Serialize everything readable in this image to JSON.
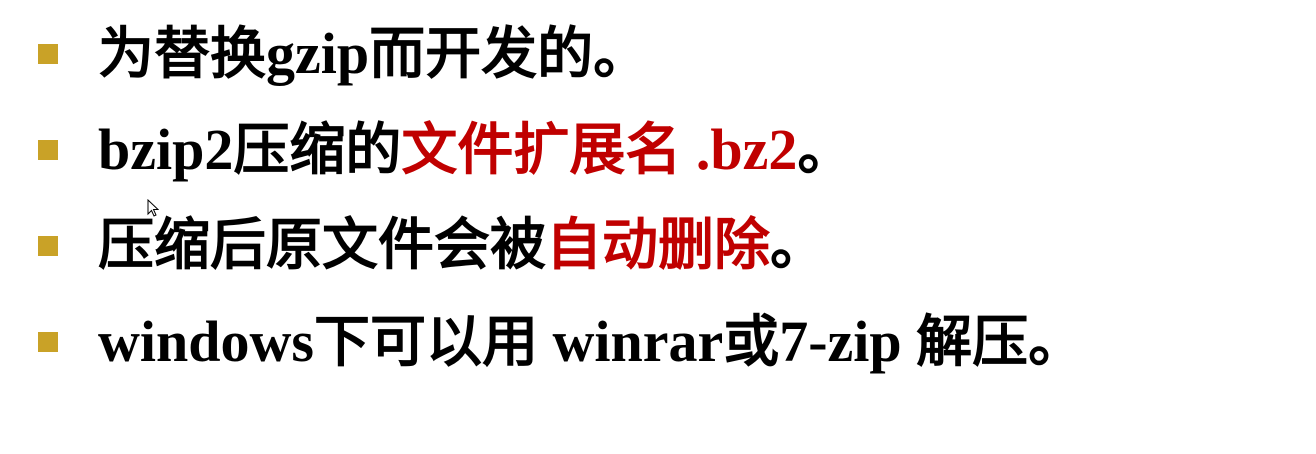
{
  "colors": {
    "bullet": "#c9a227",
    "text": "#000000",
    "highlight": "#c00000",
    "background": "#ffffff"
  },
  "bullets": [
    {
      "segments": [
        {
          "text": "为替换",
          "style": "cjk",
          "color": "#000000"
        },
        {
          "text": "gzip",
          "style": "latin",
          "color": "#000000"
        },
        {
          "text": "而开发的。",
          "style": "cjk",
          "color": "#000000"
        }
      ]
    },
    {
      "segments": [
        {
          "text": "bzip2",
          "style": "latin",
          "color": "#000000"
        },
        {
          "text": "压缩的",
          "style": "cjk",
          "color": "#000000"
        },
        {
          "text": "文件扩展名",
          "style": "cjk",
          "color": "#c00000"
        },
        {
          "text": " .bz2",
          "style": "latin",
          "color": "#c00000"
        },
        {
          "text": "。",
          "style": "cjk",
          "color": "#000000"
        }
      ]
    },
    {
      "segments": [
        {
          "text": "压缩后原文件会被",
          "style": "cjk",
          "color": "#000000"
        },
        {
          "text": "自动删除",
          "style": "cjk",
          "color": "#c00000"
        },
        {
          "text": "。",
          "style": "cjk",
          "color": "#000000"
        }
      ]
    },
    {
      "segments": [
        {
          "text": "windows",
          "style": "latin",
          "color": "#000000"
        },
        {
          "text": "下可以用",
          "style": "cjk",
          "color": "#000000"
        },
        {
          "text": " winrar",
          "style": "latin",
          "color": "#000000"
        },
        {
          "text": "或",
          "style": "cjk",
          "color": "#000000"
        },
        {
          "text": "7-zip ",
          "style": "latin",
          "color": "#000000"
        },
        {
          "text": "解压。",
          "style": "cjk",
          "color": "#000000"
        }
      ]
    }
  ],
  "cursor_icon": "mouse-pointer-icon"
}
